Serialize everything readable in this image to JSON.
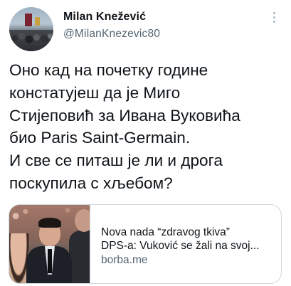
{
  "author": {
    "display_name": "Milan Knežević",
    "handle": "@MilanKnezevic80"
  },
  "tweet": {
    "lines": [
      "Оно кад на почетку године",
      "констатујеш да је Миго",
      "Стијеповић за Ивана Вуковића",
      "био Paris Saint-Germain.",
      "И све се питаш је ли и дрога",
      "поскупила с хљебом?"
    ]
  },
  "link_card": {
    "title": "Nova nada “zdravog tkiva”",
    "description": "DPS-a: Vuković se žali na svoj...",
    "domain": "borba.me"
  },
  "icons": {
    "more": "more-options-icon"
  }
}
